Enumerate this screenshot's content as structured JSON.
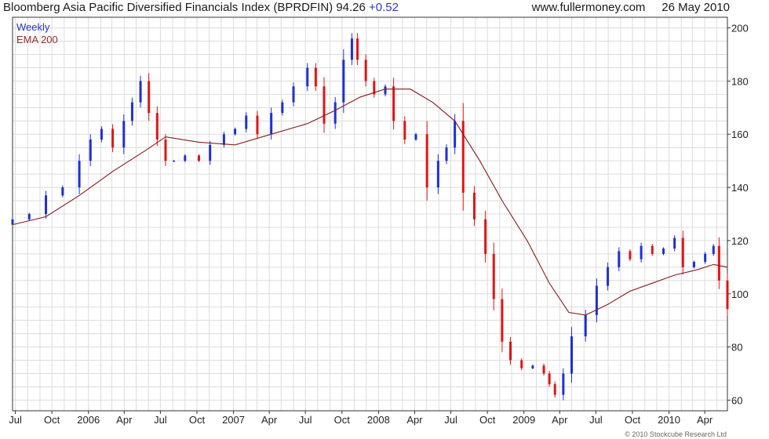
{
  "header": {
    "title": "Bloomberg Asia Pacific Diversified Financials Index (BPRDFIN) 94.26",
    "change": "+0.52",
    "site": "www.fullermoney.com",
    "date": "26 May 2010"
  },
  "legend": {
    "weekly": "Weekly",
    "ema": "EMA 200"
  },
  "copyright": "© 2010 Stockcube Research Ltd",
  "colors": {
    "up": "#1f2fd6",
    "down": "#e01515",
    "ema": "#8b1a1a",
    "grid": "#dcdcdc",
    "axis": "#333333"
  },
  "chart_data": {
    "type": "line",
    "title": "Bloomberg Asia Pacific Diversified Financials Index (BPRDFIN) 94.26 +0.52",
    "xlabel": "",
    "ylabel": "",
    "ylim": [
      56,
      204
    ],
    "xlim": [
      "2005-06-24",
      "2010-05-28"
    ],
    "grid": true,
    "legend_placement": "top-left",
    "y_ticks": [
      60,
      80,
      100,
      120,
      140,
      160,
      180,
      200
    ],
    "x_ticks": [
      {
        "label": "Jul",
        "date": "2005-07-01"
      },
      {
        "label": "Oct",
        "date": "2005-10-01"
      },
      {
        "label": "2006",
        "date": "2006-01-01"
      },
      {
        "label": "Apr",
        "date": "2006-04-01"
      },
      {
        "label": "Jul",
        "date": "2006-07-01"
      },
      {
        "label": "Oct",
        "date": "2006-10-01"
      },
      {
        "label": "2007",
        "date": "2007-01-01"
      },
      {
        "label": "Apr",
        "date": "2007-04-01"
      },
      {
        "label": "Jul",
        "date": "2007-07-01"
      },
      {
        "label": "Oct",
        "date": "2007-10-01"
      },
      {
        "label": "2008",
        "date": "2008-01-01"
      },
      {
        "label": "Apr",
        "date": "2008-04-01"
      },
      {
        "label": "Jul",
        "date": "2008-07-01"
      },
      {
        "label": "Oct",
        "date": "2008-10-01"
      },
      {
        "label": "2009",
        "date": "2009-01-01"
      },
      {
        "label": "Apr",
        "date": "2009-04-01"
      },
      {
        "label": "Jul",
        "date": "2009-07-01"
      },
      {
        "label": "Oct",
        "date": "2009-10-01"
      },
      {
        "label": "2010",
        "date": "2010-01-01"
      },
      {
        "label": "Apr",
        "date": "2010-04-01"
      }
    ],
    "series": [
      {
        "name": "Weekly",
        "kind": "close",
        "x": [
          "2005-06-24",
          "2005-08-05",
          "2005-09-16",
          "2005-10-28",
          "2005-12-09",
          "2006-01-06",
          "2006-02-03",
          "2006-03-03",
          "2006-03-31",
          "2006-04-21",
          "2006-05-12",
          "2006-06-02",
          "2006-06-23",
          "2006-07-14",
          "2006-08-04",
          "2006-09-01",
          "2006-10-06",
          "2006-11-03",
          "2006-12-08",
          "2007-01-05",
          "2007-02-02",
          "2007-03-02",
          "2007-04-06",
          "2007-05-04",
          "2007-06-01",
          "2007-07-06",
          "2007-07-27",
          "2007-08-17",
          "2007-09-14",
          "2007-10-05",
          "2007-10-26",
          "2007-11-09",
          "2007-11-30",
          "2007-12-21",
          "2008-01-18",
          "2008-02-08",
          "2008-03-07",
          "2008-04-04",
          "2008-05-02",
          "2008-05-30",
          "2008-06-20",
          "2008-07-11",
          "2008-08-01",
          "2008-08-29",
          "2008-09-26",
          "2008-10-17",
          "2008-11-07",
          "2008-11-28",
          "2008-12-26",
          "2009-01-23",
          "2009-02-20",
          "2009-03-06",
          "2009-03-20",
          "2009-04-10",
          "2009-05-01",
          "2009-06-05",
          "2009-07-03",
          "2009-07-31",
          "2009-08-28",
          "2009-09-25",
          "2009-10-23",
          "2009-11-20",
          "2009-12-18",
          "2010-01-15",
          "2010-02-05",
          "2010-03-05",
          "2010-04-02",
          "2010-04-23",
          "2010-05-07",
          "2010-05-28"
        ],
        "values": [
          128,
          130,
          137,
          140,
          150,
          158,
          162,
          155,
          165,
          172,
          180,
          168,
          158,
          150,
          150,
          152,
          150,
          156,
          160,
          162,
          167,
          160,
          168,
          172,
          178,
          185,
          178,
          164,
          172,
          188,
          196,
          188,
          180,
          175,
          178,
          165,
          158,
          160,
          140,
          150,
          155,
          165,
          138,
          128,
          115,
          98,
          82,
          75,
          72,
          73,
          70,
          66,
          62,
          70,
          84,
          92,
          103,
          110,
          116,
          113,
          118,
          115,
          117,
          121,
          110,
          112,
          115,
          118,
          105,
          94.26
        ]
      },
      {
        "name": "EMA 200",
        "x": [
          "2005-06-24",
          "2005-09-16",
          "2005-12-09",
          "2006-03-03",
          "2006-05-26",
          "2006-07-14",
          "2006-10-06",
          "2007-01-05",
          "2007-04-06",
          "2007-07-06",
          "2007-09-14",
          "2007-11-16",
          "2008-01-18",
          "2008-03-21",
          "2008-05-16",
          "2008-07-11",
          "2008-09-12",
          "2008-11-07",
          "2009-01-09",
          "2009-03-06",
          "2009-04-24",
          "2009-06-05",
          "2009-07-31",
          "2009-09-25",
          "2009-11-20",
          "2010-01-15",
          "2010-03-12",
          "2010-04-23",
          "2010-05-28"
        ],
        "values": [
          126,
          129,
          137,
          146,
          154,
          159,
          157,
          156,
          160,
          164,
          169,
          174,
          177,
          177,
          172,
          165,
          150,
          135,
          120,
          104,
          93,
          92,
          96,
          101,
          104,
          107,
          109,
          111,
          110
        ]
      }
    ]
  }
}
